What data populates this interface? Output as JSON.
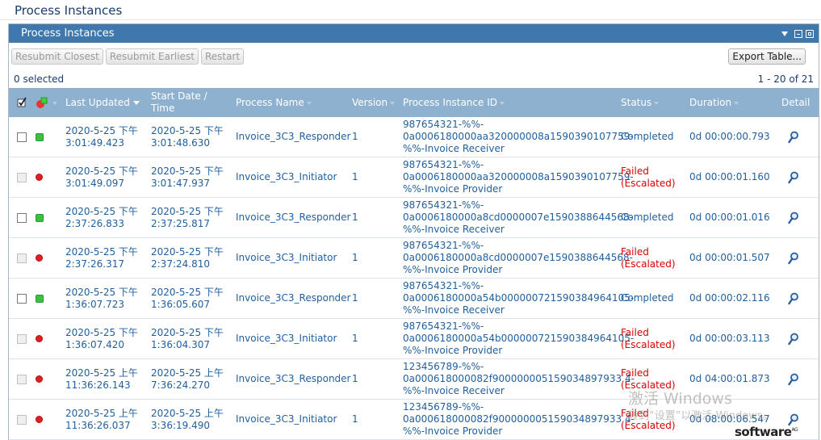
{
  "page": {
    "title": "Process Instances"
  },
  "panel": {
    "title": "Process Instances"
  },
  "toolbar": {
    "resubmit_closest": "Resubmit Closest",
    "resubmit_earliest": "Resubmit Earliest",
    "restart": "Restart",
    "export": "Export Table..."
  },
  "selection": {
    "selected_text": "0 selected",
    "paging_text": "1 - 20 of 21"
  },
  "columns": {
    "last_updated": "Last Updated",
    "start_date_1": "Start Date /",
    "start_date_2": "Time",
    "process_name": "Process Name",
    "version": "Version",
    "instance_id": "Process Instance ID",
    "status": "Status",
    "duration": "Duration",
    "detail": "Detail"
  },
  "rows": [
    {
      "updated": [
        "2020-5-25 下午",
        "3:01:49.423"
      ],
      "start": [
        "2020-5-25 下午",
        "3:01:48.630"
      ],
      "name": "Invoice_3C3_Responder",
      "version": "1",
      "id": [
        "987654321-%%-",
        "0a0006180000aa320000008a1590390107759-",
        "%%-Invoice Receiver"
      ],
      "status": [
        "Completed"
      ],
      "status_color": "blue",
      "duration": "0d 00:00:00.793",
      "indicator": "green",
      "checkbox_enabled": true
    },
    {
      "updated": [
        "2020-5-25 下午",
        "3:01:49.097"
      ],
      "start": [
        "2020-5-25 下午",
        "3:01:47.937"
      ],
      "name": "Invoice_3C3_Initiator",
      "version": "1",
      "id": [
        "987654321-%%-",
        "0a0006180000aa320000008a1590390107759-",
        "%%-Invoice Provider"
      ],
      "status": [
        "Failed",
        "(Escalated)"
      ],
      "status_color": "red",
      "duration": "0d 00:00:01.160",
      "indicator": "red",
      "checkbox_enabled": false
    },
    {
      "updated": [
        "2020-5-25 下午",
        "2:37:26.833"
      ],
      "start": [
        "2020-5-25 下午",
        "2:37:25.817"
      ],
      "name": "Invoice_3C3_Responder",
      "version": "1",
      "id": [
        "987654321-%%-",
        "0a0006180000a8cd0000007e1590388644568-",
        "%%-Invoice Receiver"
      ],
      "status": [
        "Completed"
      ],
      "status_color": "blue",
      "duration": "0d 00:00:01.016",
      "indicator": "green",
      "checkbox_enabled": true
    },
    {
      "updated": [
        "2020-5-25 下午",
        "2:37:26.317"
      ],
      "start": [
        "2020-5-25 下午",
        "2:37:24.810"
      ],
      "name": "Invoice_3C3_Initiator",
      "version": "1",
      "id": [
        "987654321-%%-",
        "0a0006180000a8cd0000007e1590388644568-",
        "%%-Invoice Provider"
      ],
      "status": [
        "Failed",
        "(Escalated)"
      ],
      "status_color": "red",
      "duration": "0d 00:00:01.507",
      "indicator": "red",
      "checkbox_enabled": false
    },
    {
      "updated": [
        "2020-5-25 下午",
        "1:36:07.723"
      ],
      "start": [
        "2020-5-25 下午",
        "1:36:05.607"
      ],
      "name": "Invoice_3C3_Responder",
      "version": "1",
      "id": [
        "987654321-%%-",
        "0a0006180000a54b000000721590384964105-",
        "%%-Invoice Receiver"
      ],
      "status": [
        "Completed"
      ],
      "status_color": "blue",
      "duration": "0d 00:00:02.116",
      "indicator": "green",
      "checkbox_enabled": true
    },
    {
      "updated": [
        "2020-5-25 下午",
        "1:36:07.420"
      ],
      "start": [
        "2020-5-25 下午",
        "1:36:04.307"
      ],
      "name": "Invoice_3C3_Initiator",
      "version": "1",
      "id": [
        "987654321-%%-",
        "0a0006180000a54b000000721590384964105-",
        "%%-Invoice Provider"
      ],
      "status": [
        "Failed",
        "(Escalated)"
      ],
      "status_color": "red",
      "duration": "0d 00:00:03.113",
      "indicator": "red",
      "checkbox_enabled": false
    },
    {
      "updated": [
        "2020-5-25 上午",
        "11:36:26.143"
      ],
      "start": [
        "2020-5-25 上午",
        "7:36:24.270"
      ],
      "name": "Invoice_3C3_Responder",
      "version": "1",
      "id": [
        "123456789-%%-",
        "0a000618000082f900000005159034897933 4-",
        "%%-Invoice Receiver"
      ],
      "status": [
        "Failed",
        "(Escalated)"
      ],
      "status_color": "red",
      "duration": "0d 04:00:01.873",
      "indicator": "red",
      "checkbox_enabled": false
    },
    {
      "updated": [
        "2020-5-25 上午",
        "11:36:26.037"
      ],
      "start": [
        "2020-5-25 上午",
        "3:36:19.490"
      ],
      "name": "Invoice_3C3_Initiator",
      "version": "1",
      "id": [
        "123456789-%%-",
        "0a000618000082f900000005159034897933 4-",
        "%%-Invoice Provider"
      ],
      "status": [
        "Failed",
        "(Escalated)"
      ],
      "status_color": "red",
      "duration": "0d 08:00:06.547",
      "indicator": "red",
      "checkbox_enabled": false
    }
  ],
  "watermark": {
    "line1": "激活 Windows",
    "line2": "转到“设置”以激活 Windows。"
  },
  "brand": {
    "name": "software",
    "suffix": "AG"
  },
  "colors": {
    "header_bar": "#3e78ac",
    "grid_header": "#8fb1d0",
    "link_blue": "#1f5f9e",
    "failed_red": "#d80000",
    "completed_indicator": "#3fbf3f",
    "failed_indicator": "#e02020"
  },
  "icons": {
    "detail": "magnifier-icon",
    "select_all": "select-all-icon",
    "status_legend": "status-indicator-icon"
  }
}
